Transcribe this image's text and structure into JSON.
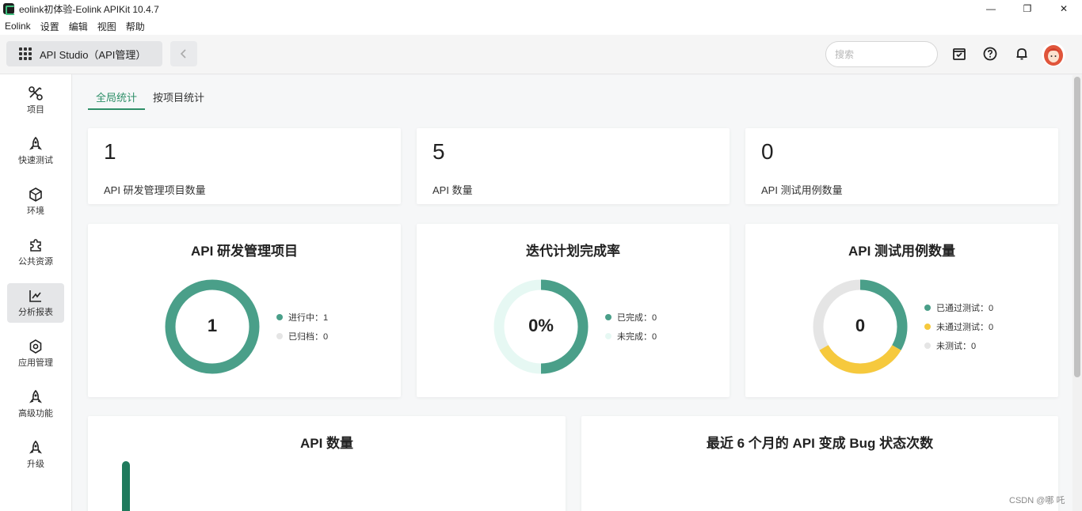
{
  "window": {
    "title": "eolink初体验-Eolink APIKit 10.4.7",
    "minimize": "—",
    "restore": "❐",
    "close": "✕"
  },
  "menu": [
    "Eolink",
    "设置",
    "编辑",
    "视图",
    "帮助"
  ],
  "toolbar": {
    "studio_label": "API Studio（API管理）",
    "search_placeholder": "搜索"
  },
  "sidebar": {
    "items": [
      {
        "label": "项目",
        "icon": "project-icon"
      },
      {
        "label": "快速测试",
        "icon": "rocket-icon"
      },
      {
        "label": "环境",
        "icon": "cube-icon"
      },
      {
        "label": "公共资源",
        "icon": "puzzle-icon"
      },
      {
        "label": "分析报表",
        "icon": "chart-icon",
        "active": true
      },
      {
        "label": "应用管理",
        "icon": "gear-icon"
      },
      {
        "label": "高级功能",
        "icon": "rocket-icon"
      },
      {
        "label": "升级",
        "icon": "rocket-icon"
      }
    ]
  },
  "tabs": [
    {
      "label": "全局统计",
      "active": true
    },
    {
      "label": "按项目统计",
      "active": false
    }
  ],
  "stats": [
    {
      "value": "1",
      "label": "API 研发管理项目数量"
    },
    {
      "value": "5",
      "label": "API 数量"
    },
    {
      "value": "0",
      "label": "API 测试用例数量"
    }
  ],
  "charts": {
    "projects": {
      "title": "API 研发管理项目",
      "center": "1",
      "legend": [
        {
          "label": "进行中：1",
          "color": "#4a9f89"
        },
        {
          "label": "已归档：0",
          "color": "#e5e5e5"
        }
      ]
    },
    "iteration": {
      "title": "迭代计划完成率",
      "center": "0%",
      "legend": [
        {
          "label": "已完成：0",
          "color": "#4a9f89"
        },
        {
          "label": "未完成：0",
          "color": "#e6f8f3"
        }
      ]
    },
    "testcases": {
      "title": "API 测试用例数量",
      "center": "0",
      "legend": [
        {
          "label": "已通过测试：0",
          "color": "#4a9f89"
        },
        {
          "label": "未通过测试：0",
          "color": "#f6c93d"
        },
        {
          "label": "未测试：0",
          "color": "#e5e5e5"
        }
      ]
    },
    "api_count": {
      "title": "API 数量"
    },
    "bug_states": {
      "title": "最近 6 个月的 API 变成 Bug 状态次数"
    }
  },
  "watermark": "CSDN @哪 吒",
  "colors": {
    "accent": "#2e8f68",
    "ring_green": "#4a9f89",
    "ring_yellow": "#f6c93d",
    "ring_gray": "#e5e5e5",
    "ring_light": "#e6f8f3"
  }
}
